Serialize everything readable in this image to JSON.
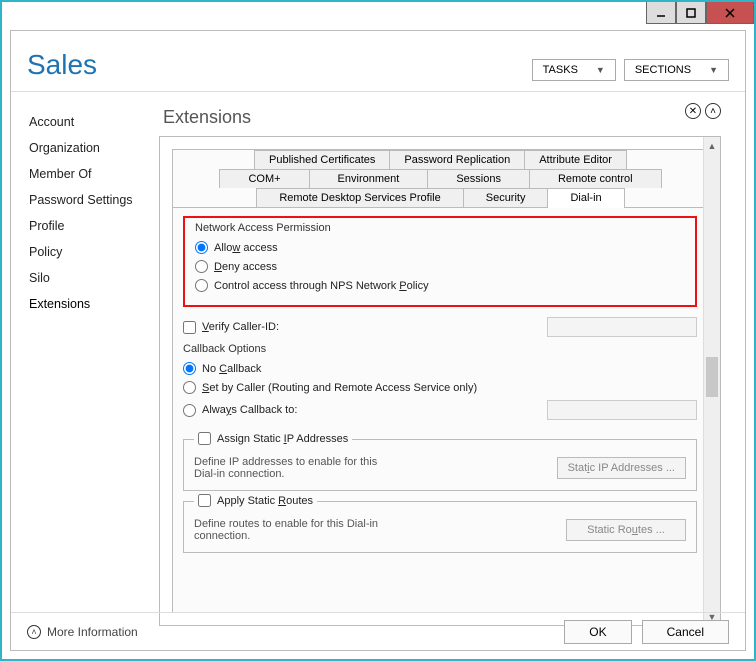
{
  "header": {
    "title": "Sales",
    "tasks": "TASKS",
    "sections": "SECTIONS"
  },
  "sidebar": {
    "items": [
      "Account",
      "Organization",
      "Member Of",
      "Password Settings",
      "Profile",
      "Policy",
      "Silo",
      "Extensions"
    ],
    "active": "Extensions"
  },
  "main": {
    "title": "Extensions"
  },
  "tabs": {
    "row1": [
      "Published Certificates",
      "Password Replication",
      "Attribute Editor"
    ],
    "row2": [
      "COM+",
      "Environment",
      "Sessions",
      "Remote control"
    ],
    "row3": [
      "Remote Desktop Services Profile",
      "Security",
      "Dial-in"
    ],
    "active": "Dial-in"
  },
  "nap": {
    "title": "Network Access Permission",
    "opt1_pre": "Allo",
    "opt1_u": "w",
    "opt1_post": " access",
    "opt2_pre": "",
    "opt2_u": "D",
    "opt2_post": "eny access",
    "opt3_pre": "Control access through NPS Network ",
    "opt3_u": "P",
    "opt3_post": "olicy"
  },
  "verify": {
    "pre": "",
    "u": "V",
    "post": "erify Caller-ID:"
  },
  "callback": {
    "title": "Callback Options",
    "o1_pre": "No ",
    "o1_u": "C",
    "o1_post": "allback",
    "o2_pre": "",
    "o2_u": "S",
    "o2_post": "et by Caller (Routing and Remote Access Service only)",
    "o3_pre": "Alwa",
    "o3_u": "y",
    "o3_post": "s Callback to:"
  },
  "ip": {
    "chk_pre": "Assign Static ",
    "chk_u": "I",
    "chk_post": "P Addresses",
    "desc": "Define IP addresses to enable for this Dial-in connection.",
    "btn_pre": "Stat",
    "btn_u": "i",
    "btn_post": "c IP Addresses ..."
  },
  "routes": {
    "chk_pre": "Apply Static ",
    "chk_u": "R",
    "chk_post": "outes",
    "desc": "Define routes to enable for this Dial-in connection.",
    "btn_pre": "Static Ro",
    "btn_u": "u",
    "btn_post": "tes ..."
  },
  "footer": {
    "more": "More Information",
    "ok": "OK",
    "cancel": "Cancel"
  }
}
